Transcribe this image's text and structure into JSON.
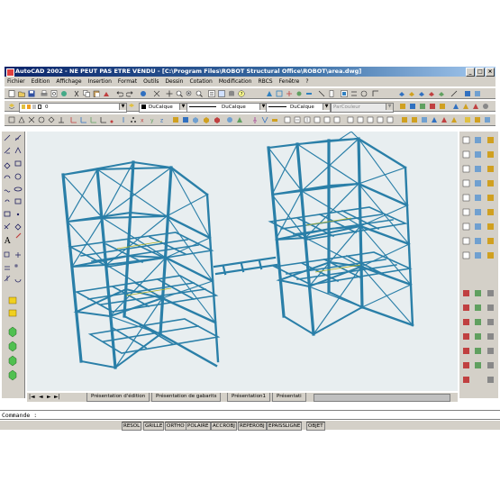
{
  "window": {
    "title": "AutoCAD 2002 - NE PEUT PAS ETRE VENDU - [C:\\Program Files\\ROBOT Structural Office\\ROBOT\\area.dwg]"
  },
  "menu": [
    "Fichier",
    "Edition",
    "Affichage",
    "Insertion",
    "Format",
    "Outils",
    "Dessin",
    "Cotation",
    "Modification",
    "RBCS",
    "Fenêtre",
    "?"
  ],
  "layer_combo": {
    "value": "0"
  },
  "color_combo": {
    "value": "DuCalque"
  },
  "linetype_combo": {
    "value": "DuCalque"
  },
  "lineweight_combo": {
    "value": "DuCalque"
  },
  "plotstyle_combo": {
    "value": "ParCouleur"
  },
  "tabs": [
    "Présentation d'édition",
    "Présentation de gabarits",
    "Présentation1",
    "Présentati"
  ],
  "command": {
    "prompt": "Commande :"
  },
  "status_buttons": [
    "RESOL",
    "GRILLE",
    "ORTHO",
    "POLAIRE",
    "ACCROBJ",
    "REPEROBJ",
    "EPAISSLIGNE",
    "OBJET"
  ]
}
